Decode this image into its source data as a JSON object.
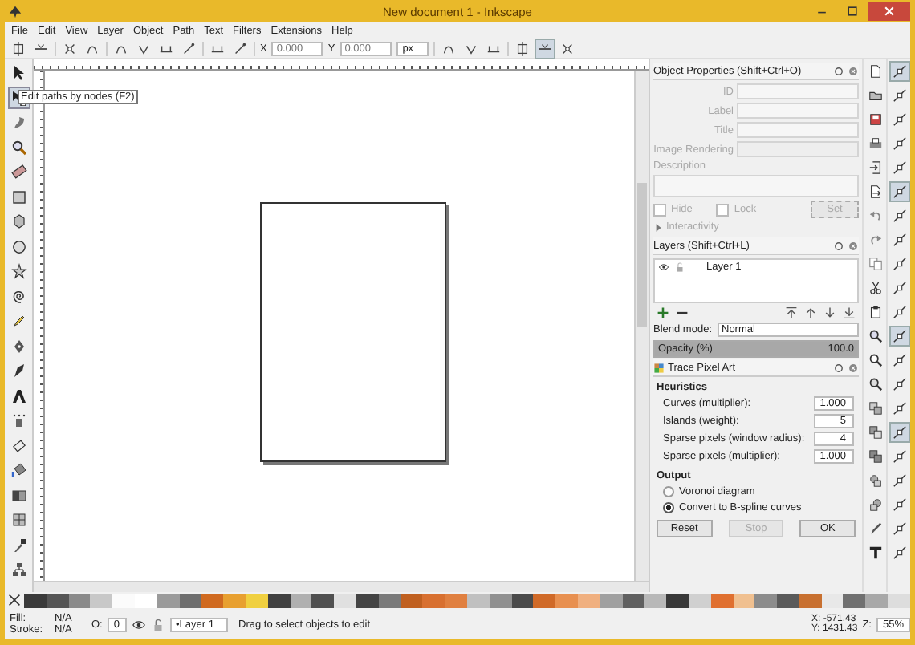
{
  "window": {
    "title": "New document 1 - Inkscape"
  },
  "menu": [
    "File",
    "Edit",
    "View",
    "Layer",
    "Object",
    "Path",
    "Text",
    "Filters",
    "Extensions",
    "Help"
  ],
  "toolbar": {
    "x_label": "X",
    "x_value": "0.000",
    "y_label": "Y",
    "y_value": "0.000",
    "units": "px"
  },
  "tools": [
    {
      "selected": false
    },
    {
      "selected": true
    },
    {
      "selected": false
    },
    {
      "selected": false
    },
    {
      "selected": false
    },
    {
      "selected": false
    },
    {
      "selected": false
    },
    {
      "selected": false
    },
    {
      "selected": false
    },
    {
      "selected": false
    },
    {
      "selected": false
    },
    {
      "selected": false
    },
    {
      "selected": false
    },
    {
      "selected": false
    },
    {
      "selected": false
    },
    {
      "selected": false
    },
    {
      "selected": false
    },
    {
      "selected": false
    },
    {
      "selected": false
    },
    {
      "selected": false
    },
    {
      "selected": false
    }
  ],
  "tooltip": "Edit paths by nodes (F2)",
  "object_properties": {
    "title": "Object Properties (Shift+Ctrl+O)",
    "disabled": true,
    "fields": [
      {
        "label": "ID"
      },
      {
        "label": "Label"
      },
      {
        "label": "Title"
      }
    ],
    "image_rendering": "Image Rendering",
    "description": "Description",
    "checkboxes": [
      {
        "label": "Hide",
        "checked": false
      },
      {
        "label": "Lock",
        "checked": false
      }
    ],
    "set_button": "Set",
    "interactivity": {
      "label": "Interactivity",
      "expanded": false
    }
  },
  "layers": {
    "title": "Layers (Shift+Ctrl+L)",
    "rows": [
      {
        "name": "Layer 1",
        "visible": true,
        "locked": false
      }
    ],
    "blend_label": "Blend mode:",
    "blend_value": "Normal",
    "opacity_label": "Opacity (%)",
    "opacity_value": "100.0",
    "level": 1
  },
  "trace": {
    "title": "Trace Pixel Art",
    "heuristics_label": "Heuristics",
    "params": [
      {
        "label": "Curves (multiplier):",
        "value": "1.000"
      },
      {
        "label": "Islands (weight):",
        "value": "5"
      },
      {
        "label": "Sparse pixels (window radius):",
        "value": "4"
      },
      {
        "label": "Sparse pixels (multiplier):",
        "value": "1.000"
      }
    ],
    "output_label": "Output",
    "options": [
      {
        "label": "Voronoi diagram",
        "selected": false
      },
      {
        "label": "Convert to B-spline curves",
        "selected": true
      }
    ],
    "buttons": [
      {
        "label": "Reset",
        "disabled": false
      },
      {
        "label": "Stop",
        "disabled": true
      },
      {
        "label": "OK",
        "disabled": false
      }
    ]
  },
  "snap_controls": [
    {
      "on": true
    },
    {
      "on": false
    },
    {
      "on": false
    },
    {
      "on": false
    },
    {
      "on": false
    },
    {
      "on": true
    },
    {
      "on": false
    },
    {
      "on": false
    },
    {
      "on": false
    },
    {
      "on": false
    },
    {
      "on": false
    },
    {
      "on": true
    },
    {
      "on": false
    },
    {
      "on": false
    },
    {
      "on": false
    },
    {
      "on": true
    },
    {
      "on": false
    },
    {
      "on": false
    },
    {
      "on": false
    },
    {
      "on": false
    },
    {
      "on": false
    }
  ],
  "palette": [
    {
      "color": "#3a3a3a"
    },
    {
      "color": "#555555"
    },
    {
      "color": "#8a8a8a"
    },
    {
      "color": "#c8c8c8"
    },
    {
      "color": "#fbfbfb"
    },
    {
      "color": "#ffffff"
    },
    {
      "color": "#9a9a9a"
    },
    {
      "color": "#6e6e6e"
    },
    {
      "color": "#d06a20"
    },
    {
      "color": "#e8a030"
    },
    {
      "color": "#f0d040"
    },
    {
      "color": "#404040"
    },
    {
      "color": "#b0b0b0"
    },
    {
      "color": "#505050"
    },
    {
      "color": "#e0e0e0"
    },
    {
      "color": "#444444"
    },
    {
      "color": "#7a7a7a"
    },
    {
      "color": "#c06020"
    },
    {
      "color": "#d87030"
    },
    {
      "color": "#e08040"
    },
    {
      "color": "#c0c0c0"
    },
    {
      "color": "#909090"
    },
    {
      "color": "#4a4a4a"
    },
    {
      "color": "#d06a28"
    },
    {
      "color": "#e89050"
    },
    {
      "color": "#f0b080"
    },
    {
      "color": "#a0a0a0"
    },
    {
      "color": "#606060"
    },
    {
      "color": "#b8b8b8"
    },
    {
      "color": "#383838"
    },
    {
      "color": "#d0d0d0"
    },
    {
      "color": "#e07030"
    },
    {
      "color": "#f0c090"
    },
    {
      "color": "#8c8c8c"
    },
    {
      "color": "#5a5a5a"
    },
    {
      "color": "#c87030"
    },
    {
      "color": "#e8e8e8"
    },
    {
      "color": "#707070"
    },
    {
      "color": "#a8a8a8"
    },
    {
      "color": "#dddddd"
    }
  ],
  "status": {
    "fill_label": "Fill:",
    "fill_value": "N/A",
    "stroke_label": "Stroke:",
    "stroke_value": "N/A",
    "opacity_label": "O:",
    "opacity_value": "0",
    "layer": "•Layer 1",
    "message": "Drag to select objects to edit",
    "x_label": "X:",
    "x_value": "-571.43",
    "y_label": "Y:",
    "y_value": "1431.43",
    "zoom_label": "Z:",
    "zoom_value": "55%"
  }
}
